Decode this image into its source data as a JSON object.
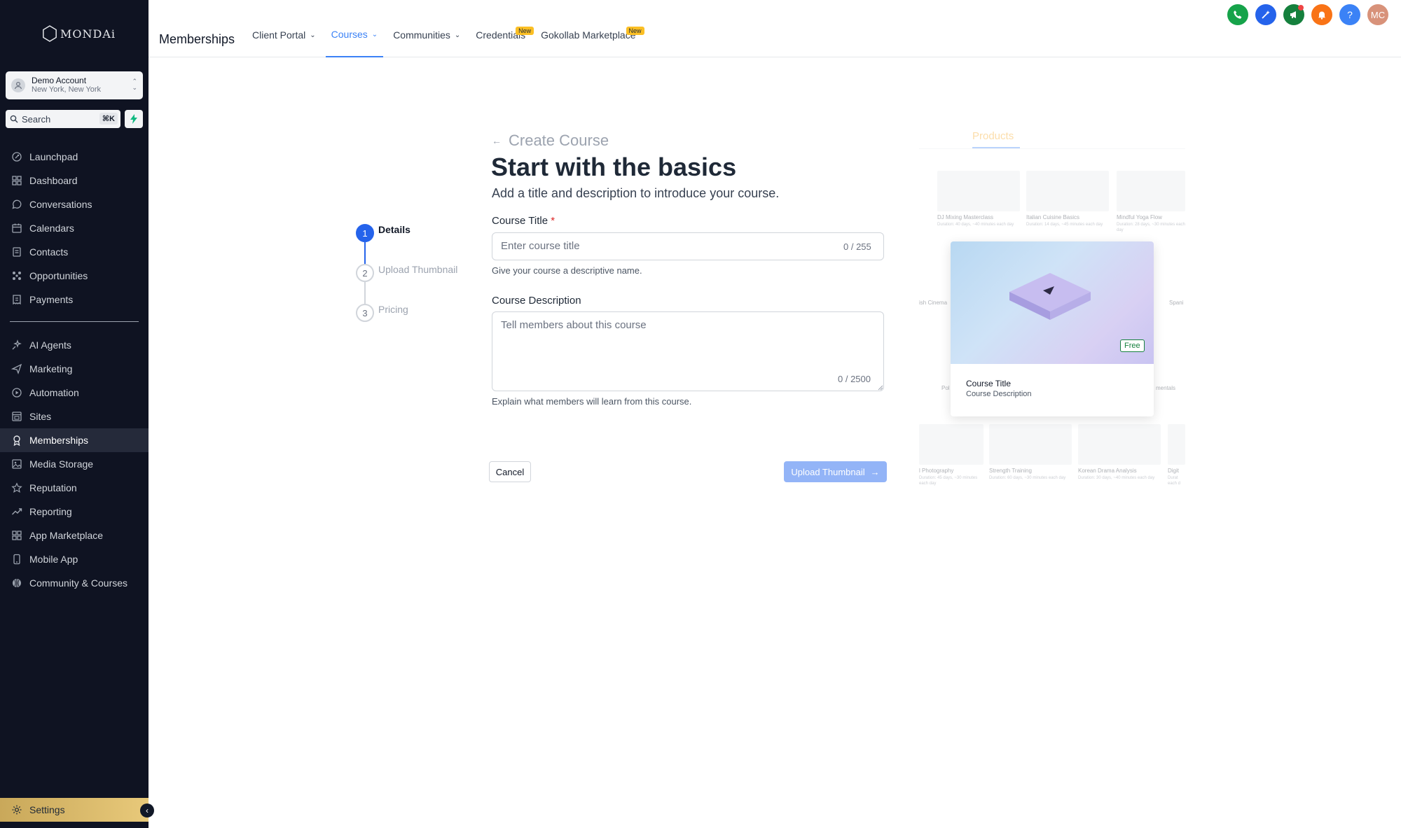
{
  "brand": {
    "logo_text": "MONDAi"
  },
  "account": {
    "name": "Demo Account",
    "location": "New York, New York"
  },
  "search": {
    "placeholder": "Search",
    "shortcut": "⌘K"
  },
  "sidebar": {
    "items": [
      {
        "label": "Launchpad",
        "icon": "rocket-icon"
      },
      {
        "label": "Dashboard",
        "icon": "grid-icon"
      },
      {
        "label": "Conversations",
        "icon": "chat-icon"
      },
      {
        "label": "Calendars",
        "icon": "calendar-icon"
      },
      {
        "label": "Contacts",
        "icon": "contacts-icon"
      },
      {
        "label": "Opportunities",
        "icon": "opportunities-icon"
      },
      {
        "label": "Payments",
        "icon": "payments-icon"
      }
    ],
    "items2": [
      {
        "label": "AI Agents",
        "icon": "sparkle-icon"
      },
      {
        "label": "Marketing",
        "icon": "send-icon"
      },
      {
        "label": "Automation",
        "icon": "automation-icon"
      },
      {
        "label": "Sites",
        "icon": "sites-icon"
      },
      {
        "label": "Memberships",
        "icon": "award-icon",
        "active": true
      },
      {
        "label": "Media Storage",
        "icon": "image-icon"
      },
      {
        "label": "Reputation",
        "icon": "star-icon"
      },
      {
        "label": "Reporting",
        "icon": "trend-icon"
      },
      {
        "label": "App Marketplace",
        "icon": "apps-icon"
      },
      {
        "label": "Mobile App",
        "icon": "mobile-icon"
      },
      {
        "label": "Community & Courses",
        "icon": "community-icon"
      }
    ],
    "settings": "Settings"
  },
  "header": {
    "title": "Memberships",
    "tabs": [
      {
        "label": "Client Portal",
        "dropdown": true
      },
      {
        "label": "Courses",
        "dropdown": true,
        "active": true
      },
      {
        "label": "Communities",
        "dropdown": true
      },
      {
        "label": "Credentials",
        "badge": "New"
      },
      {
        "label": "Gokollab Marketplace",
        "badge": "New"
      }
    ],
    "avatar_initials": "MC",
    "help": "?"
  },
  "colors": {
    "accent": "#2563eb",
    "sidebar_bg": "#0f1322",
    "settings_gold": "#e8c97a"
  },
  "stepper": {
    "steps": [
      {
        "number": "1",
        "label": "Details",
        "active": true
      },
      {
        "number": "2",
        "label": "Upload Thumbnail"
      },
      {
        "number": "3",
        "label": "Pricing"
      }
    ]
  },
  "form": {
    "back_label": "Create Course",
    "heading": "Start with the basics",
    "subheading": "Add a title and description to introduce your course.",
    "title_label": "Course Title",
    "title_required": "*",
    "title_placeholder": "Enter course title",
    "title_count": "0 / 255",
    "title_help": "Give your course a descriptive name.",
    "desc_label": "Course Description",
    "desc_placeholder": "Tell members about this course",
    "desc_count": "0 / 2500",
    "desc_help": "Explain what members will learn from this course.",
    "cancel": "Cancel",
    "next": "Upload Thumbnail",
    "next_arrow": "→"
  },
  "preview": {
    "tab": "Products",
    "card_badge": "Free",
    "card_title": "Course Title",
    "card_description": "Course Description",
    "bg_cards": [
      {
        "title": "DJ Mixing Masterclass",
        "desc": "Duration: 40 days, ~40 minutes each day"
      },
      {
        "title": "Italian Cuisine Basics",
        "desc": "Duration: 14 days, ~45 minutes each day"
      },
      {
        "title": "Mindful Yoga Flow",
        "desc": "Duration: 28 days, ~30 minutes each day"
      },
      {
        "title": "l Photography",
        "desc": "Duration: 45 days, ~30 minutes each day"
      },
      {
        "title": "Strength Training",
        "desc": "Duration: 60 days, ~30 minutes each day"
      },
      {
        "title": "Korean Drama Analysis",
        "desc": "Duration: 30 days, ~40 minutes each day"
      },
      {
        "title": "Digit",
        "desc": "Durat each d"
      }
    ],
    "bg_fragments": [
      "ish Cinema",
      "Spani",
      "Pol",
      "mentals"
    ]
  }
}
